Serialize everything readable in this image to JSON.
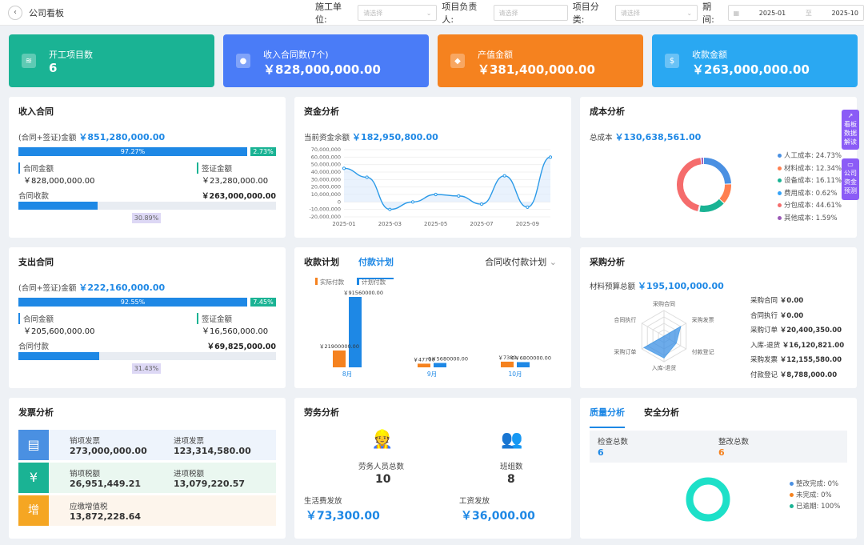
{
  "header": {
    "back": "‹",
    "title": "公司看板"
  },
  "filters": [
    {
      "label": "施工单位:",
      "placeholder": "请选择"
    },
    {
      "label": "项目负责人:",
      "placeholder": "请选择"
    },
    {
      "label": "项目分类:",
      "placeholder": "请选择"
    }
  ],
  "period": {
    "label": "期间:",
    "start": "2025-01",
    "sep": "至",
    "end": "2025-10"
  },
  "kpis": [
    {
      "label": "开工项目数",
      "value": "6",
      "color": "#1ab394"
    },
    {
      "label": "收入合同数(7个)",
      "value": "￥828,000,000.00",
      "color": "#4a7cf7"
    },
    {
      "label": "产值金额",
      "value": "￥381,400,000.00",
      "color": "#f5821f"
    },
    {
      "label": "收款金额",
      "value": "￥263,000,000.00",
      "color": "#2aa8f2"
    }
  ],
  "income": {
    "title": "收入合同",
    "total_label": "(合同+签证)金额",
    "total": "￥851,280,000.00",
    "p1": "97.27%",
    "p2": "2.73%",
    "c_label": "合同金额",
    "c_val": "￥828,000,000.00",
    "v_label": "签证金额",
    "v_val": "￥23,280,000.00",
    "r_label": "合同收款",
    "r_val": "￥263,000,000.00",
    "r_pct": "30.89%",
    "r_ratio": 0.3089,
    "main_ratio": 0.9727
  },
  "expense": {
    "title": "支出合同",
    "total_label": "(合同+签证)金额",
    "total": "￥222,160,000.00",
    "p1": "92.55%",
    "p2": "7.45%",
    "c_label": "合同金额",
    "c_val": "￥205,600,000.00",
    "v_label": "签证金额",
    "v_val": "￥16,560,000.00",
    "r_label": "合同付款",
    "r_val": "￥69,825,000.00",
    "r_pct": "31.43%",
    "r_ratio": 0.3143,
    "main_ratio": 0.9255
  },
  "funds": {
    "title": "资金分析",
    "label": "当前资金余额",
    "value": "￥182,950,800.00"
  },
  "chart_data": [
    {
      "type": "line",
      "x": [
        "2025-01",
        "2025-02",
        "2025-03",
        "2025-04",
        "2025-05",
        "2025-06",
        "2025-07",
        "2025-08",
        "2025-09",
        "2025-10"
      ],
      "ticks": [
        "2025-01",
        "2025-03",
        "2025-05",
        "2025-07",
        "2025-09"
      ],
      "values": [
        45000000,
        33000000,
        -10000000,
        0,
        10000000,
        8000000,
        -3000000,
        35000000,
        -7000000,
        60000000
      ],
      "ylim": [
        -20000000,
        70000000
      ],
      "yticks": [
        "70,000,000",
        "60,000,000",
        "50,000,000",
        "40,000,000",
        "30,000,000",
        "20,000,000",
        "10,000,000",
        "0",
        "-10,000,000",
        "-20,000,000"
      ]
    },
    {
      "type": "bar",
      "categories": [
        "8月",
        "9月",
        "10月"
      ],
      "series": [
        {
          "name": "实际付款",
          "values": [
            21900000,
            4770000,
            7380000
          ],
          "labels": [
            "￥21900000.00",
            "￥47700",
            "￥7380"
          ]
        },
        {
          "name": "计划付款",
          "values": [
            91560000,
            5680000,
            6800000
          ],
          "labels": [
            "￥91560000.00",
            "0￥5680000.00",
            "0￥6800000.00"
          ]
        }
      ]
    },
    {
      "type": "pie",
      "series": [
        {
          "name": "人工成本",
          "value": 24.73,
          "color": "#4a90e2"
        },
        {
          "name": "材料成本",
          "value": 12.34,
          "color": "#ff7f50"
        },
        {
          "name": "设备成本",
          "value": 16.11,
          "color": "#1ab394"
        },
        {
          "name": "费用成本",
          "value": 0.62,
          "color": "#36a3f7"
        },
        {
          "name": "分包成本",
          "value": 44.61,
          "color": "#f56c6c"
        },
        {
          "name": "其他成本",
          "value": 1.59,
          "color": "#9b59b6"
        }
      ]
    }
  ],
  "cost": {
    "title": "成本分析",
    "label": "总成本",
    "value": "￥130,638,561.00",
    "legend": [
      "人工成本: 24.73%",
      "材料成本: 12.34%",
      "设备成本: 16.11%",
      "费用成本: 0.62%",
      "分包成本: 44.61%",
      "其他成本: 1.59%"
    ]
  },
  "plan": {
    "tab1": "收款计划",
    "tab2": "付款计划",
    "dropdown": "合同收付款计划"
  },
  "purchase": {
    "title": "采购分析",
    "label": "材料预算总额",
    "value": "￥195,100,000.00",
    "axes": [
      "采购合同",
      "采购发票",
      "付款登记",
      "入库-退货",
      "采购订单",
      "合同执行"
    ],
    "rows": [
      [
        "采购合同",
        "￥0.00"
      ],
      [
        "合同执行",
        "￥0.00"
      ],
      [
        "采购订单",
        "￥20,400,350.00"
      ],
      [
        "入库-退货",
        "￥16,120,821.00"
      ],
      [
        "采购发票",
        "￥12,155,580.00"
      ],
      [
        "付款登记",
        "￥8,788,000.00"
      ]
    ]
  },
  "invoice": {
    "title": "发票分析",
    "items": [
      [
        "销项发票",
        "273,000,000.00",
        "进项发票",
        "123,314,580.00"
      ],
      [
        "销项税额",
        "26,951,449.21",
        "进项税额",
        "13,079,220.57"
      ],
      [
        "应缴增值税",
        "13,872,228.64"
      ]
    ]
  },
  "labor": {
    "title": "劳务分析",
    "l1": "劳务人员总数",
    "v1": "10",
    "l2": "班组数",
    "v2": "8",
    "l3": "生活费发放",
    "v3": "￥73,300.00",
    "l4": "工资发放",
    "v4": "￥36,000.00"
  },
  "quality": {
    "tab1": "质量分析",
    "tab2": "安全分析",
    "l1": "检查总数",
    "v1": "6",
    "l2": "整改总数",
    "v2": "6",
    "legend": [
      "整改完成: 0%",
      "未完成: 0%",
      "已逾期: 100%"
    ]
  },
  "side": [
    "看板数据解读",
    "公司资金预测"
  ]
}
